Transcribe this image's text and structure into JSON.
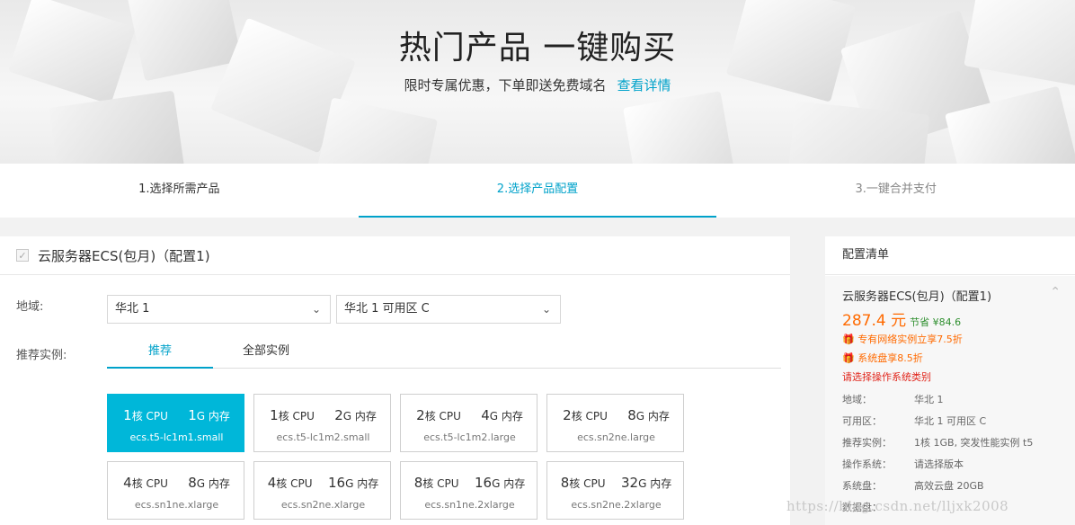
{
  "hero": {
    "title": "热门产品 一键购买",
    "subtitle": "限时专属优惠，下单即送免费域名",
    "link": "查看详情"
  },
  "steps": [
    {
      "label": "1.选择所需产品",
      "state": "done"
    },
    {
      "label": "2.选择产品配置",
      "state": "active"
    },
    {
      "label": "3.一键合并支付",
      "state": "pending"
    }
  ],
  "product": {
    "checkbox_mark": "✓",
    "title": "云服务器ECS(包月)（配置1)"
  },
  "region": {
    "label": "地域:",
    "region_value": "华北 1",
    "zone_value": "华北 1 可用区 C"
  },
  "instance": {
    "label": "推荐实例:",
    "tabs": [
      "推荐",
      "全部实例"
    ],
    "active_tab": 0,
    "cards": [
      {
        "cpu_n": "1",
        "cpu_unit": "核 CPU",
        "mem_n": "1",
        "mem_unit": "G 内存",
        "code": "ecs.t5-lc1m1.small",
        "selected": true
      },
      {
        "cpu_n": "1",
        "cpu_unit": "核 CPU",
        "mem_n": "2",
        "mem_unit": "G 内存",
        "code": "ecs.t5-lc1m2.small",
        "selected": false
      },
      {
        "cpu_n": "2",
        "cpu_unit": "核 CPU",
        "mem_n": "4",
        "mem_unit": "G 内存",
        "code": "ecs.t5-lc1m2.large",
        "selected": false
      },
      {
        "cpu_n": "2",
        "cpu_unit": "核 CPU",
        "mem_n": "8",
        "mem_unit": "G 内存",
        "code": "ecs.sn2ne.large",
        "selected": false
      },
      {
        "cpu_n": "4",
        "cpu_unit": "核 CPU",
        "mem_n": "8",
        "mem_unit": "G 内存",
        "code": "ecs.sn1ne.xlarge",
        "selected": false
      },
      {
        "cpu_n": "4",
        "cpu_unit": "核 CPU",
        "mem_n": "16",
        "mem_unit": "G 内存",
        "code": "ecs.sn2ne.xlarge",
        "selected": false
      },
      {
        "cpu_n": "8",
        "cpu_unit": "核 CPU",
        "mem_n": "16",
        "mem_unit": "G 内存",
        "code": "ecs.sn1ne.2xlarge",
        "selected": false
      },
      {
        "cpu_n": "8",
        "cpu_unit": "核 CPU",
        "mem_n": "32",
        "mem_unit": "G 内存",
        "code": "ecs.sn2ne.2xlarge",
        "selected": false
      }
    ]
  },
  "summary": {
    "title": "配置清单",
    "product": "云服务器ECS(包月)（配置1)",
    "price": "287.4 元",
    "save": "节省 ¥84.6",
    "promos": [
      "专有网络实例立享7.5折",
      "系统盘享8.5折"
    ],
    "warning": "请选择操作系统类别",
    "specs": [
      {
        "k": "地域：",
        "v": "华北 1"
      },
      {
        "k": "可用区：",
        "v": "华北 1 可用区 C"
      },
      {
        "k": "推荐实例：",
        "v": "1核 1GB, 突发性能实例 t5"
      },
      {
        "k": "操作系统：",
        "v": "请选择版本"
      },
      {
        "k": "系统盘：",
        "v": "高效云盘 20GB"
      },
      {
        "k": "数据盘：",
        "v": ""
      }
    ]
  },
  "watermark": "https://blog.csdn.net/lljxk2008",
  "colors": {
    "accent": "#00a2ca",
    "card_selected": "#00b7d9",
    "price": "#ff6a00",
    "warning": "#e1251b"
  }
}
